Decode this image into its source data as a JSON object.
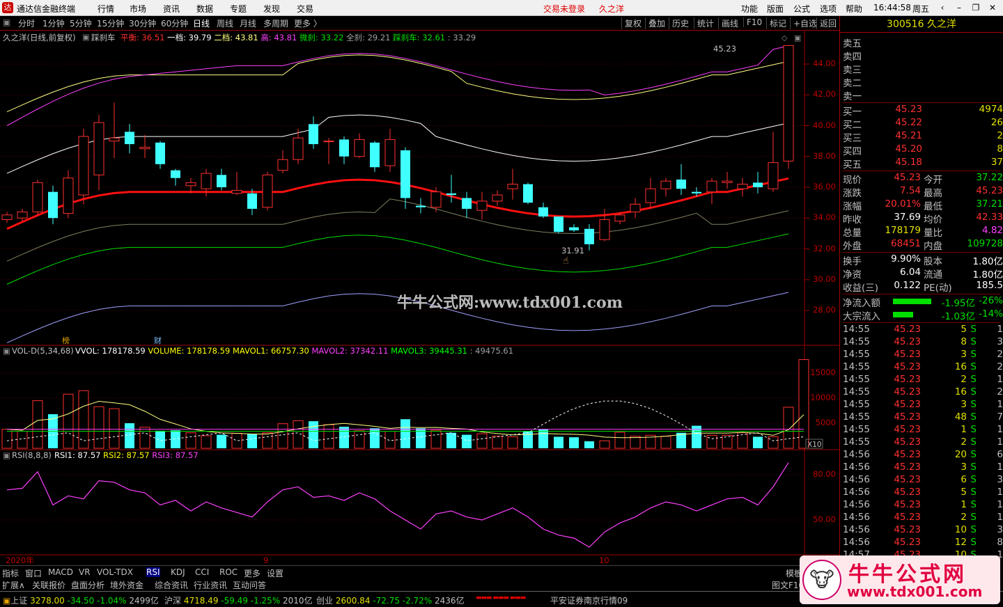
{
  "titlebar": {
    "app_name": "通达信金融终端",
    "menus": [
      "行情",
      "市场",
      "资讯",
      "数据",
      "专题",
      "发现",
      "交易"
    ],
    "login_status": "交易未登录",
    "stock_name": "久之洋",
    "right_menus": [
      "功能",
      "版面",
      "公式",
      "选项",
      "帮助"
    ],
    "time": "16:44:58",
    "weekday": "周五"
  },
  "toolbar": {
    "periods": [
      "分时",
      "1分钟",
      "5分钟",
      "15分钟",
      "30分钟",
      "60分钟",
      "日线",
      "周线",
      "月线",
      "多周期",
      "更多 〉"
    ],
    "selected": "日线",
    "right_buttons": [
      "复权",
      "叠加",
      "历史",
      "统计",
      "画线",
      "F10",
      "标记",
      "+自选",
      "返回"
    ]
  },
  "main_chart": {
    "title": "久之洋(日线,前复权)",
    "indicator": "踩刹车",
    "labels": [
      {
        "name": "平衡",
        "value": "36.51",
        "color": "#ff3030"
      },
      {
        "name": "一档",
        "value": "39.79",
        "color": "#ffffff"
      },
      {
        "name": "二档",
        "value": "43.81",
        "color": "#ffff80"
      },
      {
        "name": "高",
        "value": "43.81",
        "color": "#ff40ff"
      },
      {
        "name": "微刹",
        "value": "33.22",
        "color": "#00e000"
      },
      {
        "name": "全刹",
        "value": "29.21",
        "color": "#a0a0a0"
      },
      {
        "name": "踩刹车",
        "value": "32.61",
        "color": "#00e000"
      }
    ],
    "extra": ": 33.29",
    "high_label": "45.23",
    "low_label": "31.91",
    "y_ticks": [
      "44.00",
      "42.00",
      "40.00",
      "38.00",
      "36.00",
      "34.00",
      "32.00",
      "30.00",
      "28.00"
    ],
    "watermark": "牛牛公式网:www.tdx001.com",
    "markers": [
      "榜",
      "财"
    ]
  },
  "volume_chart": {
    "title": "VOL-D(5,34,68)",
    "labels": [
      {
        "name": "VVOL",
        "value": "178178.59",
        "color": "#ffffff"
      },
      {
        "name": "VOLUME",
        "value": "178178.59",
        "color": "#ffff00"
      },
      {
        "name": "MAVOL1",
        "value": "66757.30",
        "color": "#ffff00"
      },
      {
        "name": "MAVOL2",
        "value": "37342.11",
        "color": "#ff40ff"
      },
      {
        "name": "MAVOL3",
        "value": "39445.31",
        "color": "#00ff00"
      }
    ],
    "extra": ": 49475.61",
    "y_ticks": [
      "15000",
      "10000",
      "5000"
    ],
    "unit": "X10"
  },
  "rsi_chart": {
    "title": "RSI(8,8,8)",
    "labels": [
      {
        "name": "RSI1",
        "value": "87.57",
        "color": "#ffffff"
      },
      {
        "name": "RSI2",
        "value": "87.57",
        "color": "#ffff00"
      },
      {
        "name": "RSI3",
        "value": "87.57",
        "color": "#ff40ff"
      }
    ],
    "y_ticks": [
      "80.00",
      "50.00"
    ]
  },
  "date_axis": [
    "2020年",
    "9",
    "10"
  ],
  "bottom_tabs": [
    "指标",
    "窗口",
    "MACD",
    "VR",
    "VOL-TDX",
    "RSI",
    "KDJ",
    "CCI",
    "ROC",
    "更多",
    "设置"
  ],
  "bottom_tabs_selected": "RSI",
  "bottom_tabs2": [
    "扩展∧",
    "关联报价",
    "盘面分析",
    "境外资金",
    "综合资讯",
    "行业资讯",
    "互动问答"
  ],
  "bottom_right": [
    "模板",
    "图文F10"
  ],
  "quote_panel": {
    "code": "300516",
    "name": "久之洋",
    "sell": [
      {
        "label": "卖五",
        "price": "",
        "vol": ""
      },
      {
        "label": "卖四",
        "price": "",
        "vol": ""
      },
      {
        "label": "卖三",
        "price": "",
        "vol": ""
      },
      {
        "label": "卖二",
        "price": "",
        "vol": ""
      },
      {
        "label": "卖一",
        "price": "",
        "vol": ""
      }
    ],
    "buy": [
      {
        "label": "买一",
        "price": "45.23",
        "vol": "4974"
      },
      {
        "label": "买二",
        "price": "45.22",
        "vol": "26"
      },
      {
        "label": "买三",
        "price": "45.21",
        "vol": "2"
      },
      {
        "label": "买四",
        "price": "45.20",
        "vol": "8"
      },
      {
        "label": "买五",
        "price": "45.18",
        "vol": "37"
      }
    ],
    "stats": [
      {
        "k1": "现价",
        "v1": "45.23",
        "k2": "今开",
        "v2": "37.22",
        "c1": "#ff3030",
        "c2": "#00e000"
      },
      {
        "k1": "涨跌",
        "v1": "7.54",
        "k2": "最高",
        "v2": "45.23",
        "c1": "#ff3030",
        "c2": "#ff3030"
      },
      {
        "k1": "涨幅",
        "v1": "20.01%",
        "k2": "最低",
        "v2": "37.21",
        "c1": "#ff3030",
        "c2": "#00e000"
      },
      {
        "k1": "昨收",
        "v1": "37.69",
        "k2": "均价",
        "v2": "42.33",
        "c1": "#ffffff",
        "c2": "#ff3030"
      },
      {
        "k1": "总量",
        "v1": "178179",
        "k2": "量比",
        "v2": "4.82",
        "c1": "#e0e000",
        "c2": "#ff40ff"
      },
      {
        "k1": "外盘",
        "v1": "68451",
        "k2": "内盘",
        "v2": "109728",
        "c1": "#ff3030",
        "c2": "#00e000"
      }
    ],
    "stats2": [
      {
        "k1": "换手",
        "v1": "9.90%",
        "k2": "股本",
        "v2": "1.80亿"
      },
      {
        "k1": "净资",
        "v1": "6.04",
        "k2": "流通",
        "v2": "1.80亿"
      },
      {
        "k1": "收益(三)",
        "v1": "0.122",
        "k2": "PE(动)",
        "v2": "185.5"
      }
    ],
    "flow": [
      {
        "label": "净流入额",
        "value": "-1.95亿",
        "pct": "-26%",
        "bar": 0.26
      },
      {
        "label": "大宗流入",
        "value": "-1.03亿",
        "pct": "-14%",
        "bar": 0.14
      }
    ],
    "ticks": [
      {
        "time": "14:55",
        "price": "45.23",
        "vol": "5",
        "side": "S",
        "n": "1"
      },
      {
        "time": "14:55",
        "price": "45.23",
        "vol": "8",
        "side": "S",
        "n": "3"
      },
      {
        "time": "14:55",
        "price": "45.23",
        "vol": "3",
        "side": "S",
        "n": "2"
      },
      {
        "time": "14:55",
        "price": "45.23",
        "vol": "16",
        "side": "S",
        "n": "2"
      },
      {
        "time": "14:55",
        "price": "45.23",
        "vol": "2",
        "side": "S",
        "n": "1"
      },
      {
        "time": "14:55",
        "price": "45.23",
        "vol": "16",
        "side": "S",
        "n": "2"
      },
      {
        "time": "14:55",
        "price": "45.23",
        "vol": "3",
        "side": "S",
        "n": "1"
      },
      {
        "time": "14:55",
        "price": "45.23",
        "vol": "48",
        "side": "S",
        "n": "7"
      },
      {
        "time": "14:55",
        "price": "45.23",
        "vol": "1",
        "side": "S",
        "n": "1"
      },
      {
        "time": "14:55",
        "price": "45.23",
        "vol": "2",
        "side": "S",
        "n": "1"
      },
      {
        "time": "14:56",
        "price": "45.23",
        "vol": "20",
        "side": "S",
        "n": "6"
      },
      {
        "time": "14:56",
        "price": "45.23",
        "vol": "3",
        "side": "S",
        "n": "1"
      },
      {
        "time": "14:56",
        "price": "45.23",
        "vol": "6",
        "side": "S",
        "n": "3"
      },
      {
        "time": "14:56",
        "price": "45.23",
        "vol": "5",
        "side": "S",
        "n": "1"
      },
      {
        "time": "14:56",
        "price": "45.23",
        "vol": "1",
        "side": "S",
        "n": "1"
      },
      {
        "time": "14:56",
        "price": "45.23",
        "vol": "2",
        "side": "S",
        "n": "1"
      },
      {
        "time": "14:56",
        "price": "45.23",
        "vol": "10",
        "side": "S",
        "n": "3"
      },
      {
        "time": "14:56",
        "price": "45.23",
        "vol": "12",
        "side": "S",
        "n": "8"
      },
      {
        "time": "14:57",
        "price": "45.23",
        "vol": "10",
        "side": "S",
        "n": "1"
      }
    ]
  },
  "statusbar": {
    "items": [
      {
        "name": "上证",
        "val": "3278.00",
        "chg": "-34.50",
        "pct": "-1.04%",
        "amt": "2499亿"
      },
      {
        "name": "沪深",
        "val": "4718.49",
        "chg": "-59.49",
        "pct": "-1.25%",
        "amt": "2010亿"
      },
      {
        "name": "创业",
        "val": "2600.84",
        "chg": "-72.75",
        "pct": "-2.72%",
        "amt": "2436亿"
      }
    ],
    "broker": "平安证券南京行情09"
  },
  "logo": {
    "title": "牛牛公式网",
    "url": "www.tdx001.com"
  }
}
